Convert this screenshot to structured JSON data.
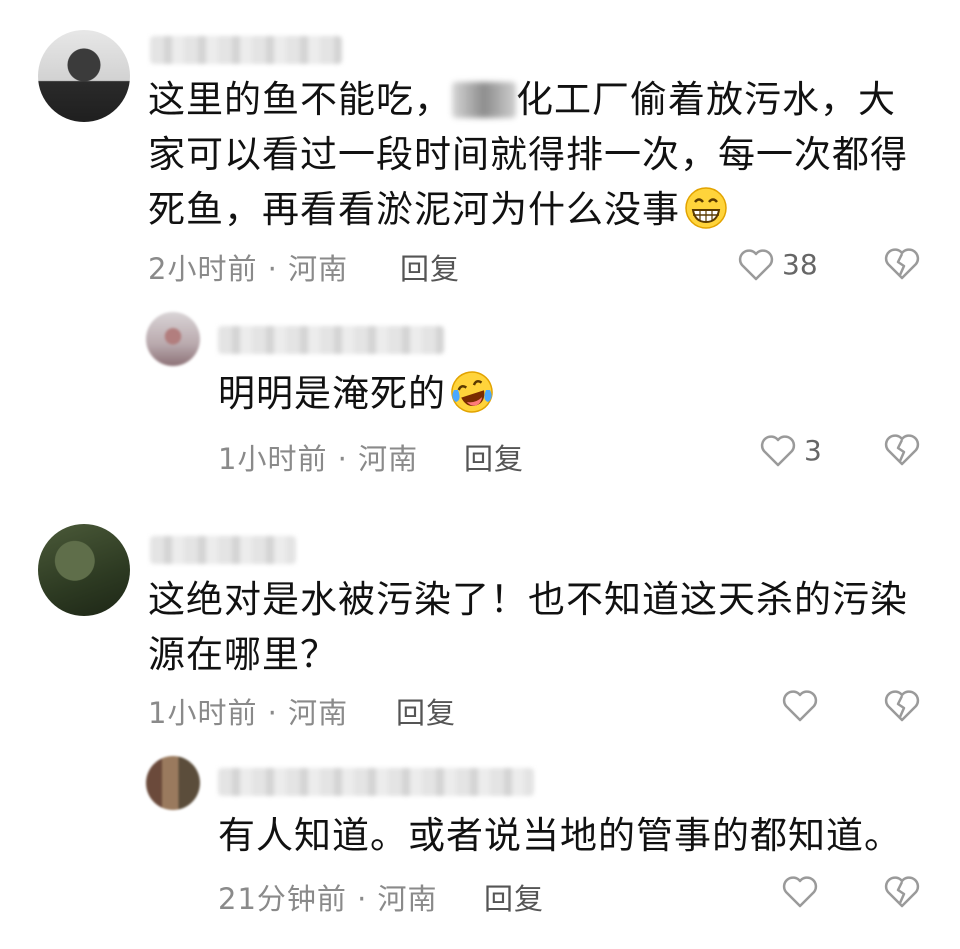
{
  "comments": [
    {
      "text_before": "这里的鱼不能吃，",
      "text_after": "化工厂偷着放污水，大",
      "line2": "家可以看过一段时间就得排一次，每一次都得",
      "line3": "死鱼，再看看淤泥河为什么没事",
      "emoji": "grin-emoji",
      "time": "2小时前 · 河南",
      "reply_label": "回复",
      "likes": "38"
    },
    {
      "text": "明明是淹死的",
      "emoji": "laugh-cry-emoji",
      "time": "1小时前 · 河南",
      "reply_label": "回复",
      "likes": "3"
    },
    {
      "line1": "这绝对是水被污染了！也不知道这天杀的污染",
      "line2": "源在哪里？",
      "time": "1小时前 · 河南",
      "reply_label": "回复",
      "likes": ""
    },
    {
      "text": "有人知道。或者说当地的管事的都知道。",
      "time": "21分钟前 · 河南",
      "reply_label": "回复",
      "likes": ""
    }
  ],
  "colors": {
    "text": "#111111",
    "meta": "#8a8a8a",
    "icon": "#9a9a9a"
  },
  "icons": {
    "like": "heart-outline-icon",
    "dislike": "broken-heart-icon"
  }
}
